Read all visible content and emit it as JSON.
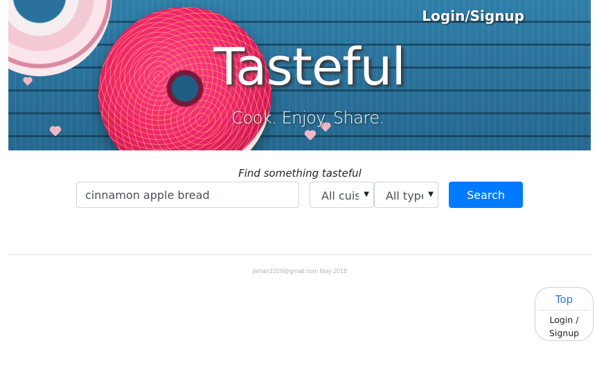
{
  "hero": {
    "login_link": "Login/Signup",
    "title": "Tasteful",
    "tagline": "Cook. Enjoy. Share."
  },
  "search": {
    "caption": "Find something tasteful",
    "query_value": "cinnamon apple bread",
    "cuisine_selected": "All cuisines",
    "type_selected": "All types",
    "button_label": "Search"
  },
  "footer": {
    "text": "jiehan1029@gmail.com May 2018"
  },
  "floating_nav": {
    "top_label": "Top",
    "login_line1": "Login /",
    "login_line2": "Signup"
  },
  "colors": {
    "primary_button": "#007bff",
    "link_blue": "#2a7bd0",
    "hero_wood": "#2a729b"
  }
}
